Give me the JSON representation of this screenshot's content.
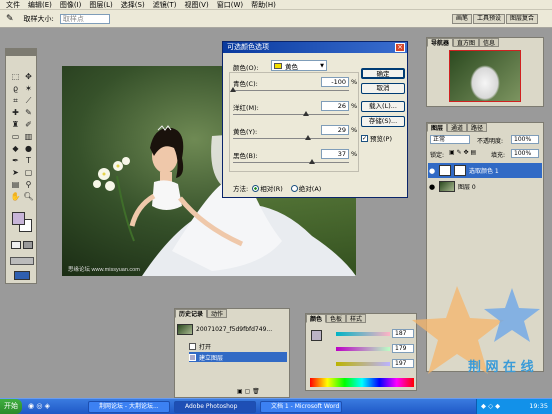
{
  "menu": [
    "文件",
    "编辑(E)",
    "图像(I)",
    "图层(L)",
    "选择(S)",
    "滤镜(T)",
    "视图(V)",
    "窗口(W)",
    "帮助(H)"
  ],
  "options": {
    "sample_label": "取样大小:",
    "sample_value": "取样点"
  },
  "swatch_tabs": [
    "画笔",
    "工具预设",
    "图层复合"
  ],
  "dialog": {
    "title": "可选颜色选项",
    "color_label": "颜色(O):",
    "color_value": "黄色",
    "sliders": [
      {
        "label": "青色(C):",
        "value": "-100",
        "fraction": 0.0
      },
      {
        "label": "洋红(M):",
        "value": "26",
        "fraction": 0.63
      },
      {
        "label": "黄色(Y):",
        "value": "29",
        "fraction": 0.645
      },
      {
        "label": "黑色(B):",
        "value": "37",
        "fraction": 0.685
      }
    ],
    "pct": "%",
    "buttons": {
      "ok": "确定",
      "cancel": "取消",
      "load": "载入(L)...",
      "save": "存储(S)..."
    },
    "preview_label": "预览(P)",
    "method_label": "方法:",
    "method_relative": "相对(R)",
    "method_absolute": "绝对(A)"
  },
  "canvas": {
    "watermark": "思缘论坛 www.missyuan.com"
  },
  "navigator": {
    "tabs": [
      "导航器",
      "直方图",
      "信息"
    ]
  },
  "layers": {
    "tabs": [
      "图层",
      "通道",
      "路径"
    ],
    "mode": "正常",
    "opacity_label": "不透明度:",
    "opacity": "100%",
    "lock_label": "锁定:",
    "fill_label": "填充:",
    "fill": "100%",
    "items": [
      {
        "name": "选取颜色 1",
        "selected": true
      },
      {
        "name": "图层 0",
        "selected": false
      }
    ]
  },
  "history": {
    "tabs": [
      "历史记录",
      "动作"
    ],
    "snapshot": "20071027_f5d9fbfd749...",
    "items": [
      {
        "name": "打开",
        "selected": false
      },
      {
        "name": "建立图层",
        "selected": true
      }
    ]
  },
  "colorpanel": {
    "tabs": [
      "颜色",
      "色板",
      "样式"
    ],
    "values": [
      "187",
      "179",
      "197"
    ]
  },
  "watermark": "荆 网 在 线",
  "taskbar": {
    "start": "开始",
    "buttons": [
      {
        "label": "荆网论坛 - 大荆论坛...",
        "active": false
      },
      {
        "label": "Adobe Photoshop",
        "active": true
      },
      {
        "label": "文档 1 - Microsoft Word",
        "active": false
      }
    ],
    "clock": "19:35"
  },
  "colors": {
    "accent": "#0a246a",
    "selection": "#316ac5",
    "taskbar": "#245edb"
  }
}
